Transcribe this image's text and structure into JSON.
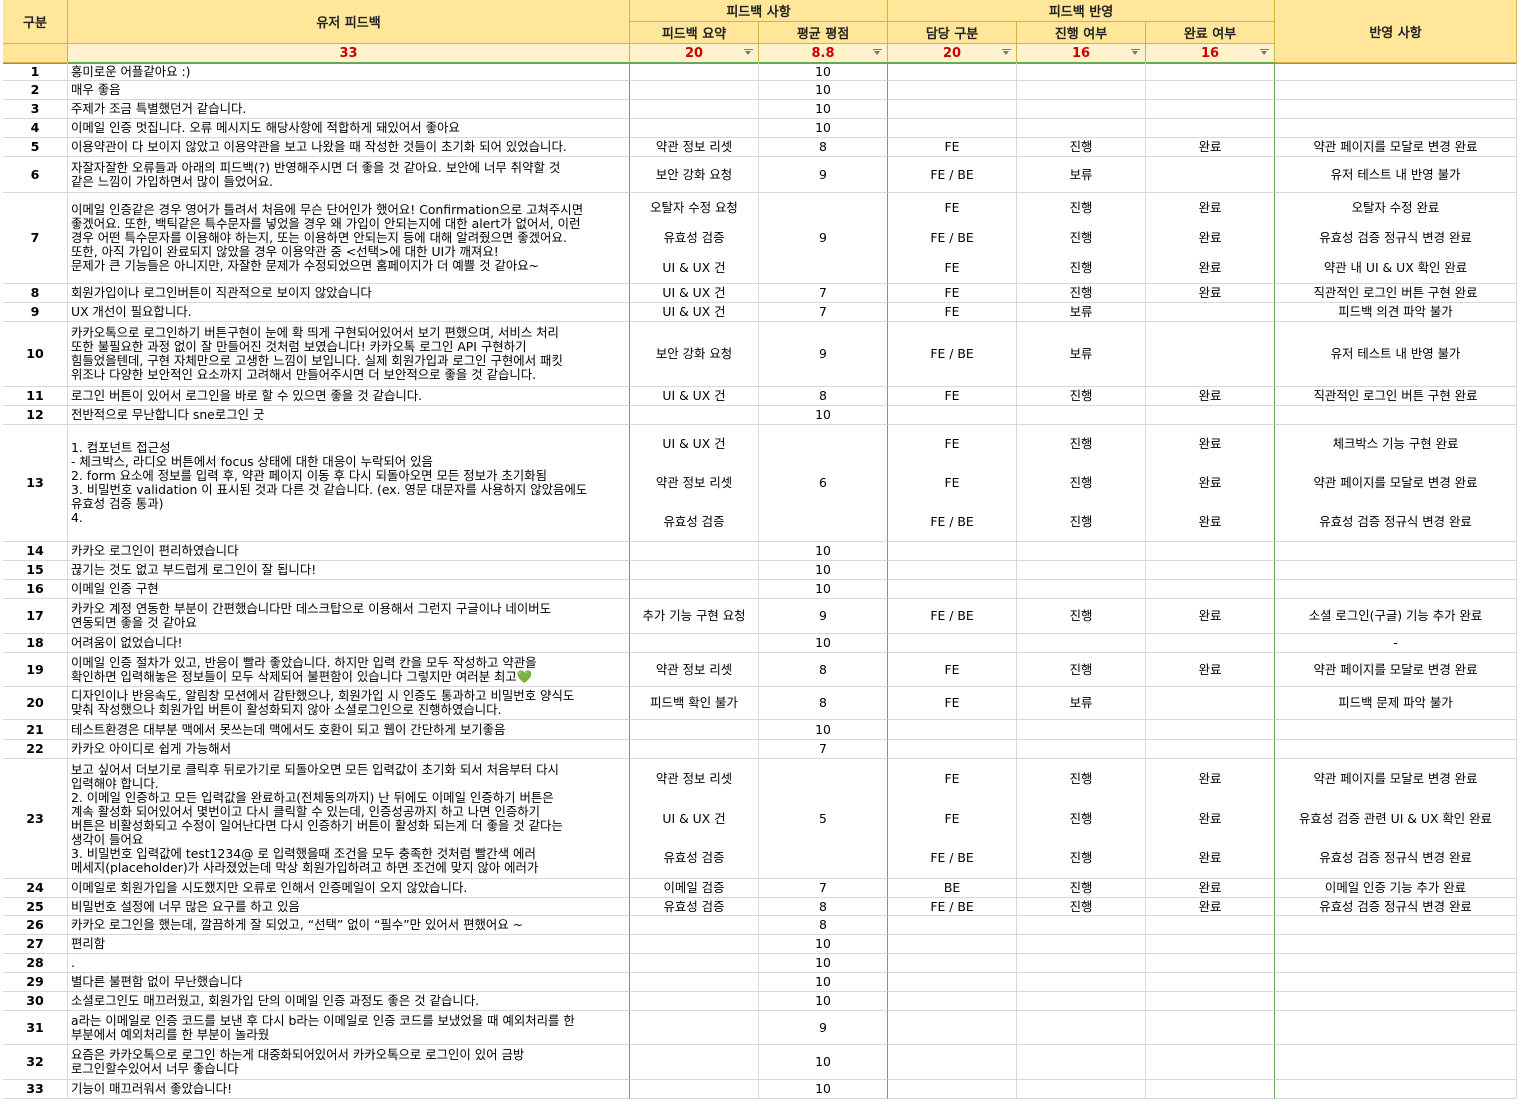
{
  "headers": {
    "gubun": "구분",
    "user_feedback": "유저 피드백",
    "feedback_items": "피드백 사항",
    "feedback_summary": "피드백 요약",
    "avg_rating": "평균 평점",
    "feedback_reflect": "피드백 반영",
    "owner": "담당 구분",
    "progress": "진행 여부",
    "done": "완료 여부",
    "reflect_notes": "반영 사항"
  },
  "summary": {
    "user_feedback": "33",
    "feedback_summary": "20",
    "avg_rating": "8.8",
    "owner": "20",
    "progress": "16",
    "done": "16"
  },
  "rows": [
    {
      "n": "1",
      "fb": "흥미로운 어플같아요 :)",
      "rating": "10",
      "subs": []
    },
    {
      "n": "2",
      "fb": "매우 좋음",
      "rating": "10",
      "subs": []
    },
    {
      "n": "3",
      "fb": "주제가 조금 특별했던거 같습니다.",
      "rating": "10",
      "subs": []
    },
    {
      "n": "4",
      "fb": "이메일 인증 멋집니다. 오류 메시지도 해당사항에 적합하게 돼있어서 좋아요",
      "rating": "10",
      "subs": []
    },
    {
      "n": "5",
      "fb": "이용약관이 다 보이지 않았고 이용약관을 보고 나왔을 때 작성한 것들이 초기화 되어 있었습니다.",
      "rating": "8",
      "subs": [
        {
          "summary": "약관 정보 리셋",
          "owner": "FE",
          "progress": "진행",
          "done": "완료",
          "note": "약관 페이지를 모달로 변경 완료"
        }
      ]
    },
    {
      "n": "6",
      "fb": "자잘자잘한 오류들과 아래의 피드백(?) 반영해주시면 더 좋을 것 같아요. 보안에 너무 취약할 것\n같은 느낌이 가입하면서 많이 들었어요.",
      "rating": "9",
      "subs": [
        {
          "summary": "보안 강화 요청",
          "owner": "FE / BE",
          "progress": "보류",
          "done": "",
          "note": "유저 테스트 내 반영 불가"
        }
      ]
    },
    {
      "n": "7",
      "fb": "이메일 인증같은 경우 영어가 틀려서 처음에 무슨 단어인가 했어요! Confirmation으로 고쳐주시면\n좋겠어요. 또한, 백틱같은 특수문자를 넣었을 경우 왜 가입이 안되는지에 대한 alert가 없어서, 이런\n경우 어떤 특수문자를 이용해야 하는지, 또는 이용하면 안되는지 등에 대해 알려줬으면 좋겠어요.\n또한, 아직 가입이 완료되지 않았을 경우 이용약관 중 <선택>에 대한 UI가 깨져요!\n문제가 큰 기능들은 아니지만, 자잘한 문제가 수정되었으면 홈페이지가 더 예쁠 것 같아요~",
      "rating": "9",
      "subs": [
        {
          "summary": "오탈자 수정 요청",
          "owner": "FE",
          "progress": "진행",
          "done": "완료",
          "note": "오탈자 수정 완료"
        },
        {
          "summary": "유효성 검증",
          "owner": "FE / BE",
          "progress": "진행",
          "done": "완료",
          "note": "유효성 검증 정규식 변경 완료"
        },
        {
          "summary": "UI & UX 건",
          "owner": "FE",
          "progress": "진행",
          "done": "완료",
          "note": "약관 내 UI & UX 확인 완료"
        }
      ]
    },
    {
      "n": "8",
      "fb": "회원가입이나 로그인버튼이 직관적으로 보이지 않았습니다",
      "rating": "7",
      "subs": [
        {
          "summary": "UI & UX 건",
          "owner": "FE",
          "progress": "진행",
          "done": "완료",
          "note": "직관적인 로그인 버튼 구현 완료"
        }
      ]
    },
    {
      "n": "9",
      "fb": "UX 개선이 필요합니다.",
      "rating": "7",
      "subs": [
        {
          "summary": "UI & UX 건",
          "owner": "FE",
          "progress": "보류",
          "done": "",
          "note": "피드백 의견 파악 불가"
        }
      ]
    },
    {
      "n": "10",
      "fb": "카카오톡으로 로그인하기 버튼구현이 눈에 확 띄게 구현되어있어서 보기 편했으며, 서비스 처리\n또한 불필요한 과정 없이 잘 만들어진 것처럼 보였습니다! 카카오톡 로그인 API 구현하기\n힘들었을텐데, 구현 자체만으로 고생한 느낌이 보입니다. 실제 회원가입과 로그인 구현에서 패킷\n위조나 다양한 보안적인 요소까지 고려해서 만들어주시면 더 보안적으로 좋을 것 같습니다.",
      "rating": "9",
      "subs": [
        {
          "summary": "보안 강화 요청",
          "owner": "FE / BE",
          "progress": "보류",
          "done": "",
          "note": "유저 테스트 내 반영 불가"
        }
      ]
    },
    {
      "n": "11",
      "fb": "로그인 버튼이 있어서 로그인을 바로 할 수 있으면 좋을 것 같습니다.",
      "rating": "8",
      "subs": [
        {
          "summary": "UI & UX 건",
          "owner": "FE",
          "progress": "진행",
          "done": "완료",
          "note": "직관적인 로그인 버튼 구현 완료"
        }
      ]
    },
    {
      "n": "12",
      "fb": "전반적으로 무난합니다 sne로그인 굿",
      "rating": "10",
      "subs": []
    },
    {
      "n": "13",
      "fb": "1. 컴포넌트 접근성\n- 체크박스, 라디오 버튼에서 focus 상태에 대한 대응이 누락되어 있음\n2. form 요소에 정보를 입력 후, 약관 페이지 이동 후 다시 되돌아오면 모든 정보가 초기화됨\n3. 비밀번호 validation 이 표시된 것과 다른 것 같습니다. (ex. 영문 대문자를 사용하지 않았음에도\n유효성 검증 통과)\n4.",
      "rating": "6",
      "subs": [
        {
          "summary": "UI & UX 건",
          "owner": "FE",
          "progress": "진행",
          "done": "완료",
          "note": "체크박스 기능 구현 완료"
        },
        {
          "summary": "약관 정보 리셋",
          "owner": "FE",
          "progress": "진행",
          "done": "완료",
          "note": "약관 페이지를 모달로 변경 완료"
        },
        {
          "summary": "유효성 검증",
          "owner": "FE / BE",
          "progress": "진행",
          "done": "완료",
          "note": "유효성 검증 정규식 변경 완료"
        }
      ]
    },
    {
      "n": "14",
      "fb": "카카오 로그인이 편리하였습니다",
      "rating": "10",
      "subs": []
    },
    {
      "n": "15",
      "fb": "끊기는 것도 없고 부드럽게 로그인이 잘 됩니다!",
      "rating": "10",
      "subs": []
    },
    {
      "n": "16",
      "fb": "이메일 인증 구현",
      "rating": "10",
      "subs": []
    },
    {
      "n": "17",
      "fb": "카카오 계정 연동한 부분이 간편했습니다만 데스크탑으로 이용해서 그런지 구글이나 네이버도\n연동되면 좋을 것 같아요",
      "rating": "9",
      "subs": [
        {
          "summary": "추가 기능 구현 요청",
          "owner": "FE / BE",
          "progress": "진행",
          "done": "완료",
          "note": "소셜 로그인(구글) 기능 추가 완료"
        }
      ]
    },
    {
      "n": "18",
      "fb": "어려움이 없었습니다!",
      "rating": "10",
      "subs": [
        {
          "summary": "",
          "owner": "",
          "progress": "",
          "done": "",
          "note": "-"
        }
      ]
    },
    {
      "n": "19",
      "fb": "이메일 인증 절차가 있고, 반응이 빨라 좋았습니다. 하지만 입력 칸을 모두 작성하고 약관을\n확인하면 입력해놓은 정보들이 모두 삭제되어 불편함이 있습니다 그렇지만 여러분 최고💚",
      "rating": "8",
      "subs": [
        {
          "summary": "약관 정보 리셋",
          "owner": "FE",
          "progress": "진행",
          "done": "완료",
          "note": "약관 페이지를 모달로 변경 완료"
        }
      ]
    },
    {
      "n": "20",
      "fb": "디자인이나 반응속도, 알림창 모션에서 감탄했으나, 회원가입 시 인증도 통과하고 비밀번호 양식도\n맞춰 작성했으나 회원가입 버튼이 활성화되지 않아 소셜로그인으로 진행하였습니다.",
      "rating": "8",
      "subs": [
        {
          "summary": "피드백 확인 불가",
          "owner": "FE",
          "progress": "보류",
          "done": "",
          "note": "피드백 문제 파악 불가"
        }
      ]
    },
    {
      "n": "21",
      "fb": "테스트환경은 대부분 맥에서 못쓰는데 맥에서도 호환이 되고 웹이 간단하게 보기좋음",
      "rating": "10",
      "subs": []
    },
    {
      "n": "22",
      "fb": "카카오 아이디로 쉽게 가능해서",
      "rating": "7",
      "subs": []
    },
    {
      "n": "23",
      "fb": "보고 싶어서 더보기로 클릭후 뒤로가기로 되돌아오면 모든 입력값이 초기화 되서 처음부터 다시\n입력해야 합니다.\n2. 이메일 인증하고 모든 입력값을 완료하고(전체동의까지) 난 뒤에도 이메일 인증하기 버튼은\n계속 활성화 되어있어서 몇번이고 다시 클릭할 수 있는데, 인증성공까지 하고 나면 인증하기\n버튼은 비활성화되고 수정이 일어난다면 다시 인증하기 버튼이 활성화 되는게 더 좋을 것 같다는\n생각이 들어요\n3. 비밀번호 입력값에 test1234@ 로 입력했을때 조건을 모두 충족한 것처럼 빨간색 에러\n메세지(placeholder)가 사라졌었는데 막상 회원가입하려고 하면 조건에 맞지 않아 에러가",
      "rating": "5",
      "subs": [
        {
          "summary": "약관 정보 리셋",
          "owner": "FE",
          "progress": "진행",
          "done": "완료",
          "note": "약관 페이지를 모달로 변경 완료"
        },
        {
          "summary": "UI & UX 건",
          "owner": "FE",
          "progress": "진행",
          "done": "완료",
          "note": "유효성 검증 관련 UI & UX 확인 완료"
        },
        {
          "summary": "유효성 검증",
          "owner": "FE / BE",
          "progress": "진행",
          "done": "완료",
          "note": "유효성 검증 정규식 변경 완료"
        }
      ]
    },
    {
      "n": "24",
      "fb": "이메일로 회원가입을 시도했지만 오류로 인해서 인증메일이 오지 않았습니다.",
      "rating": "7",
      "subs": [
        {
          "summary": "이메일 검증",
          "owner": "BE",
          "progress": "진행",
          "done": "완료",
          "note": "이메일 인증 기능 추가 완료"
        }
      ]
    },
    {
      "n": "25",
      "fb": "비밀번호 설정에 너무 많은 요구를 하고 있음",
      "rating": "8",
      "subs": [
        {
          "summary": "유효성 검증",
          "owner": "FE / BE",
          "progress": "진행",
          "done": "완료",
          "note": "유효성 검증 정규식 변경 완료"
        }
      ]
    },
    {
      "n": "26",
      "fb": "카카오 로그인을 했는데, 깔끔하게 잘 되었고, “선택” 없이 “필수”만 있어서 편했어요 ~",
      "rating": "8",
      "subs": []
    },
    {
      "n": "27",
      "fb": "편리함",
      "rating": "10",
      "subs": []
    },
    {
      "n": "28",
      "fb": ".",
      "rating": "10",
      "subs": []
    },
    {
      "n": "29",
      "fb": "별다른 불편함 없이 무난했습니다",
      "rating": "10",
      "subs": []
    },
    {
      "n": "30",
      "fb": "소셜로그인도 매끄러웠고, 회원가입 단의 이메일 인증 과정도 좋은 것 같습니다.",
      "rating": "10",
      "subs": []
    },
    {
      "n": "31",
      "fb": "a라는 이메일로 인증 코드를 보낸 후 다시 b라는 이메일로 인증 코드를 보냈었을 때 예외처리를 한\n부분에서 예외처리를 한 부분이 놀라웠",
      "rating": "9",
      "subs": []
    },
    {
      "n": "32",
      "fb": "요즘은 카카오톡으로 로그인 하는게 대중화되어있어서 카카오톡으로 로그인이 있어 금방\n로그인할수있어서 너무 좋습니다",
      "rating": "10",
      "subs": []
    },
    {
      "n": "33",
      "fb": "기능이 매끄러워서 좋았습니다!",
      "rating": "10",
      "subs": []
    }
  ]
}
